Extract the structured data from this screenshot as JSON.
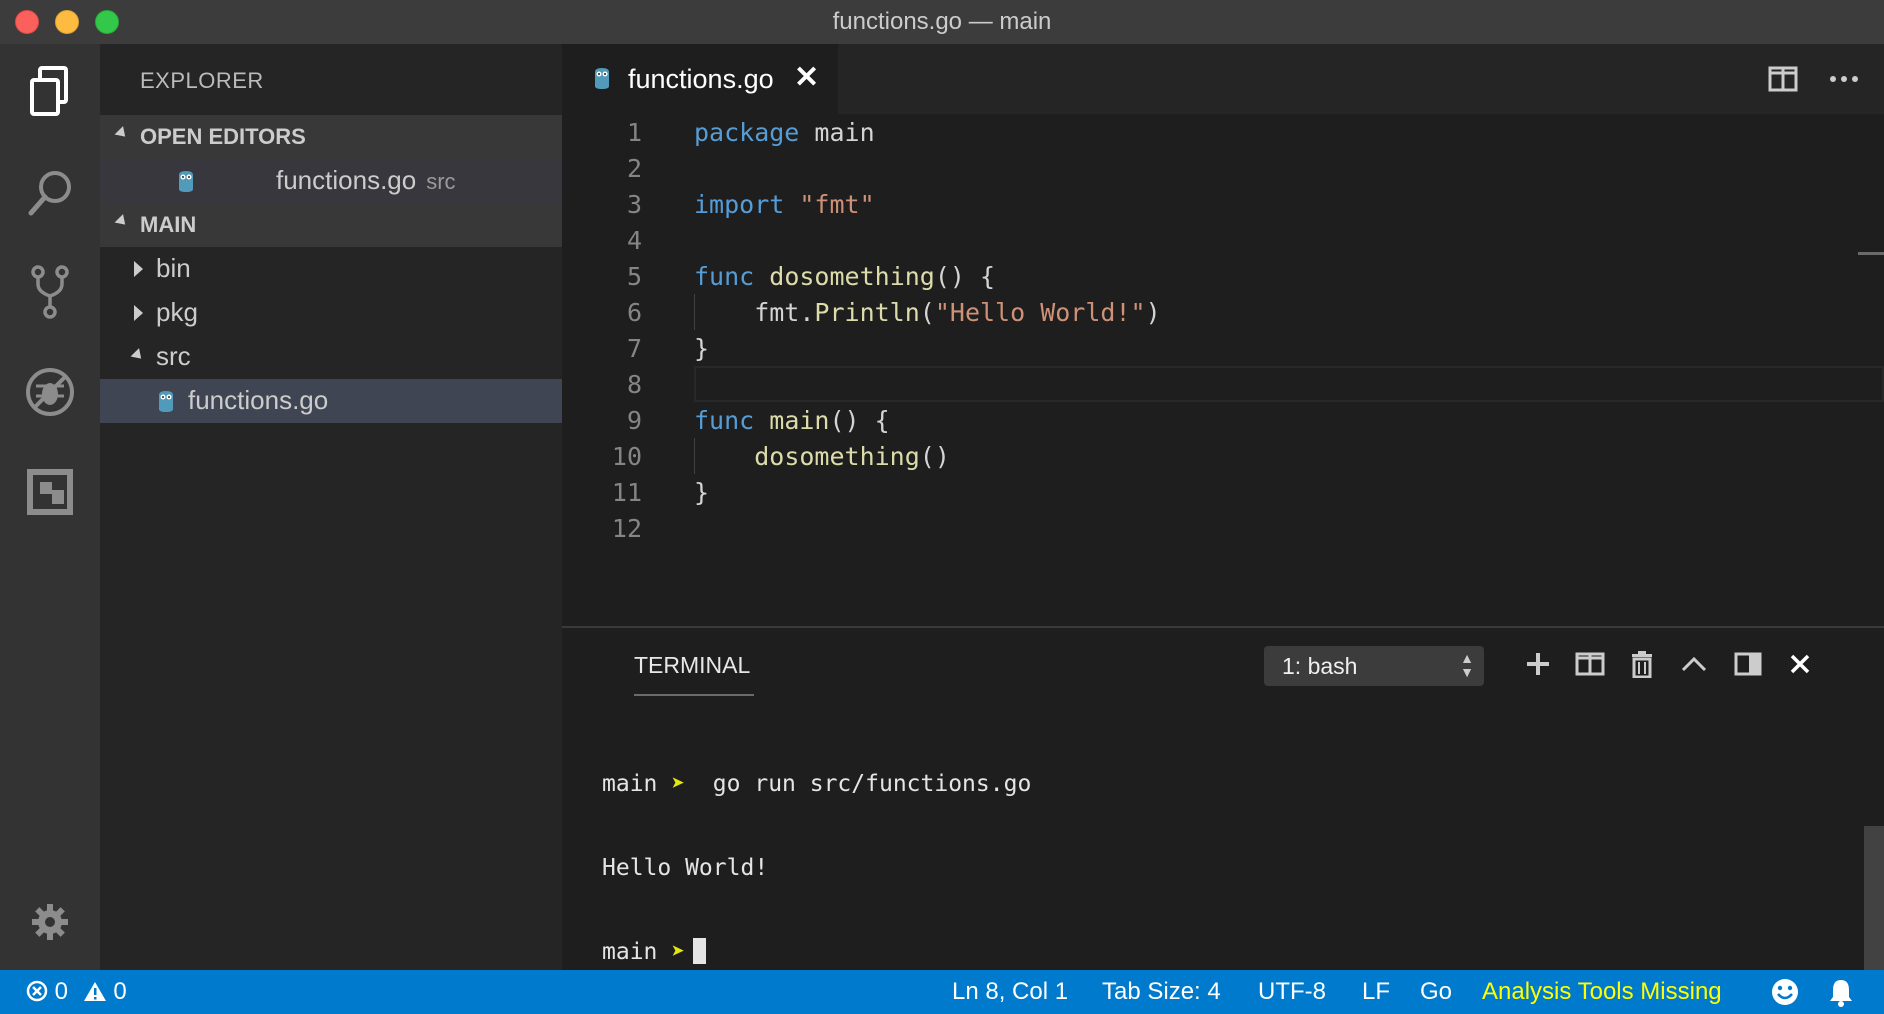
{
  "window": {
    "title": "functions.go — main"
  },
  "activity_bar": {
    "icons": [
      "files-icon",
      "search-icon",
      "source-control-icon",
      "debug-icon",
      "extensions-icon",
      "gear-icon"
    ]
  },
  "sidebar": {
    "title": "EXPLORER",
    "open_editors": {
      "header": "OPEN EDITORS",
      "items": [
        {
          "name": "functions.go",
          "path": "src"
        }
      ]
    },
    "folder": {
      "header": "MAIN",
      "items": [
        {
          "name": "bin"
        },
        {
          "name": "pkg"
        },
        {
          "name": "src"
        },
        {
          "name": "functions.go"
        }
      ]
    }
  },
  "editor": {
    "tab": {
      "name": "functions.go",
      "close": "✕"
    },
    "line_numbers": [
      "1",
      "2",
      "3",
      "4",
      "5",
      "6",
      "7",
      "8",
      "9",
      "10",
      "11",
      "12"
    ],
    "lines": [
      {
        "kw": "package",
        "rest": " main"
      },
      {},
      {
        "kw": "import",
        "sp": " ",
        "str": "\"fmt\""
      },
      {},
      {
        "kw": "func",
        "sp": " ",
        "fn": "dosomething",
        "rest": "() {"
      },
      {
        "pre": "    fmt.",
        "fn": "Println",
        "open": "(",
        "str": "\"Hello World!\"",
        "close": ")"
      },
      {
        "rest": "}"
      },
      {},
      {
        "kw": "func",
        "sp": " ",
        "fn": "main",
        "rest": "() {"
      },
      {
        "pre": "    ",
        "fn": "dosomething",
        "rest": "()"
      },
      {
        "rest": "}"
      },
      {}
    ]
  },
  "panel": {
    "tab": "TERMINAL",
    "terminal_select": "1: bash",
    "output": [
      {
        "prompt": "main",
        "arrow": "➤",
        "cmd": "  go run src/functions.go"
      },
      {
        "text": "Hello World!"
      },
      {
        "prompt": "main",
        "arrow": "➤",
        "cmd": ""
      }
    ]
  },
  "status_bar": {
    "errors": "0",
    "warnings": "0",
    "position": "Ln 8, Col 1",
    "tab_size": "Tab Size: 4",
    "encoding": "UTF-8",
    "eol": "LF",
    "language": "Go",
    "analysis": "Analysis Tools Missing"
  },
  "colors": {
    "accent": "#007acc",
    "keyword": "#569cd6",
    "string": "#ce9178",
    "function": "#dcdcaa",
    "warning_text": "#ffff00"
  }
}
